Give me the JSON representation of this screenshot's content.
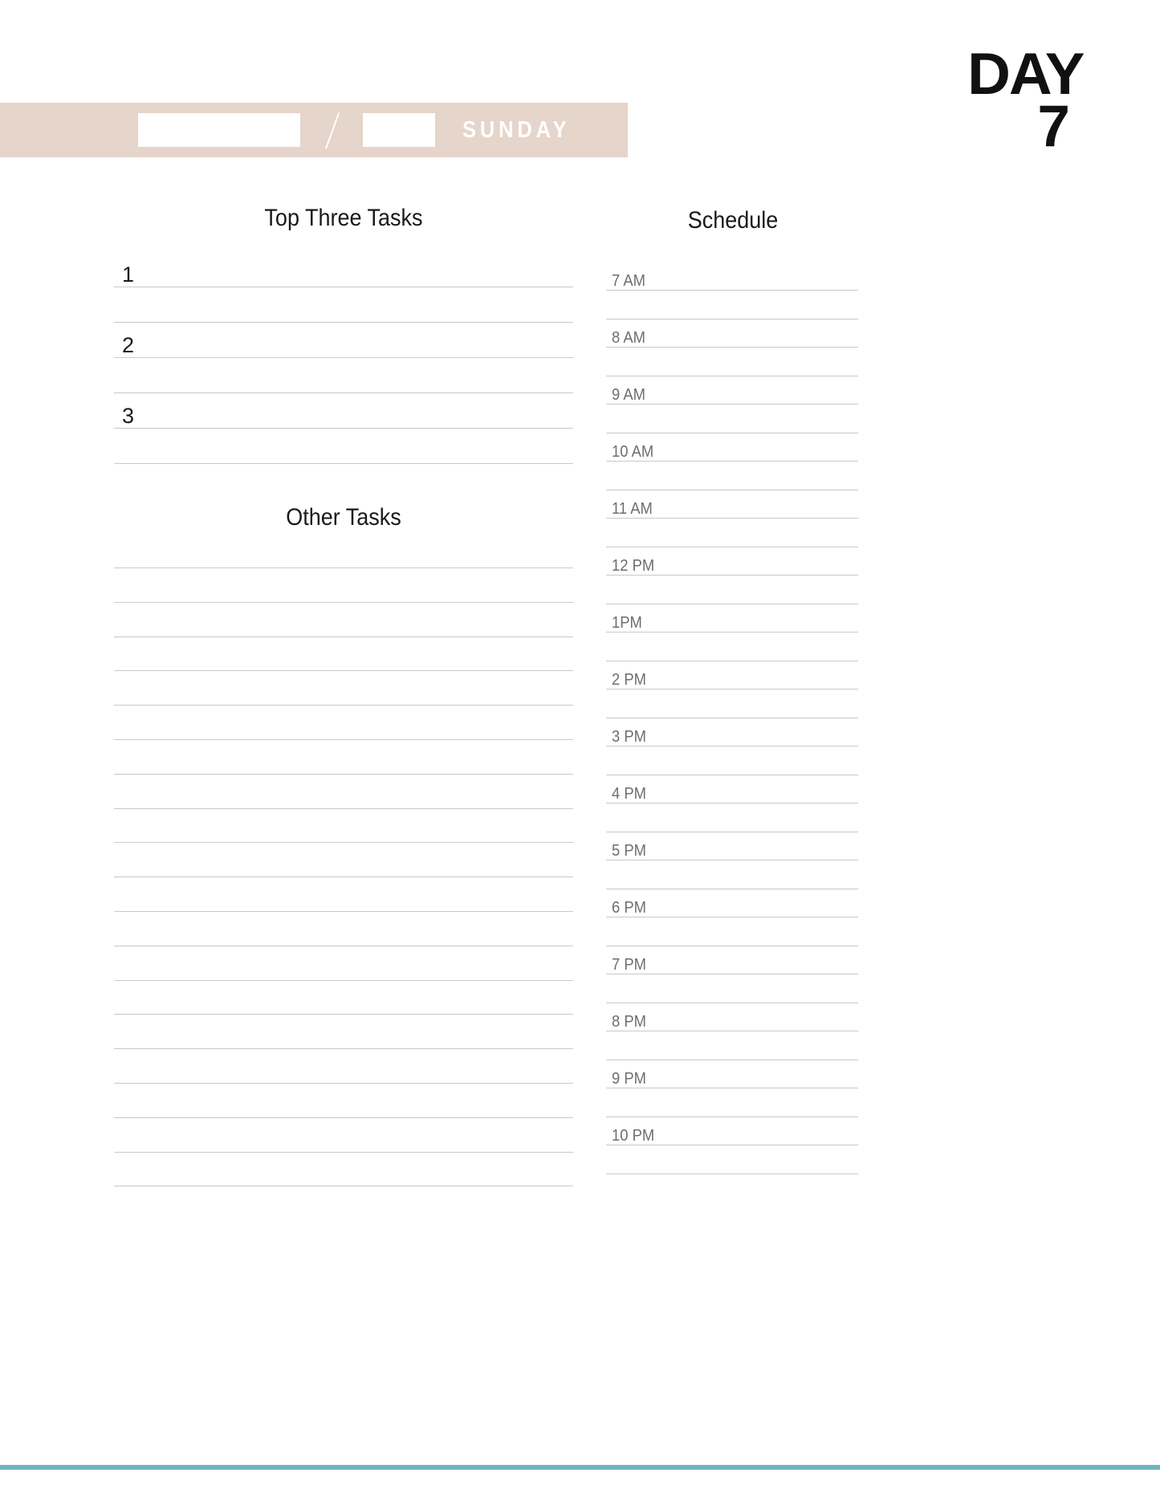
{
  "page": {
    "accent_beige": "#E6D5CB",
    "accent_teal": "#70B3C0",
    "rule_color": "#C9C9C9"
  },
  "header": {
    "month_value": "",
    "month_placeholder": "",
    "day_value": "",
    "day_placeholder": "",
    "separator": "/",
    "weekday": "SUNDAY"
  },
  "logo": {
    "word": "DAY",
    "number": "7"
  },
  "top_three": {
    "title": "Top Three Tasks",
    "items": [
      {
        "number": "1",
        "value": ""
      },
      {
        "number": "",
        "value": ""
      },
      {
        "number": "2",
        "value": ""
      },
      {
        "number": "",
        "value": ""
      },
      {
        "number": "3",
        "value": ""
      },
      {
        "number": "",
        "value": ""
      }
    ]
  },
  "other_tasks": {
    "title": "Other Tasks",
    "line_count": 19,
    "lines": [
      "",
      "",
      "",
      "",
      "",
      "",
      "",
      "",
      "",
      "",
      "",
      "",
      "",
      "",
      "",
      "",
      "",
      "",
      ""
    ]
  },
  "schedule": {
    "title": "Schedule",
    "rows": [
      {
        "label": "7 AM",
        "value": ""
      },
      {
        "label": "",
        "value": ""
      },
      {
        "label": "8 AM",
        "value": ""
      },
      {
        "label": "",
        "value": ""
      },
      {
        "label": "9 AM",
        "value": ""
      },
      {
        "label": "",
        "value": ""
      },
      {
        "label": "10 AM",
        "value": ""
      },
      {
        "label": "",
        "value": ""
      },
      {
        "label": "11 AM",
        "value": ""
      },
      {
        "label": "",
        "value": ""
      },
      {
        "label": "12 PM",
        "value": ""
      },
      {
        "label": "",
        "value": ""
      },
      {
        "label": "1PM",
        "value": ""
      },
      {
        "label": "",
        "value": ""
      },
      {
        "label": "2 PM",
        "value": ""
      },
      {
        "label": "",
        "value": ""
      },
      {
        "label": "3 PM",
        "value": ""
      },
      {
        "label": "",
        "value": ""
      },
      {
        "label": "4 PM",
        "value": ""
      },
      {
        "label": "",
        "value": ""
      },
      {
        "label": "5 PM",
        "value": ""
      },
      {
        "label": "",
        "value": ""
      },
      {
        "label": "6 PM",
        "value": ""
      },
      {
        "label": "",
        "value": ""
      },
      {
        "label": "7 PM",
        "value": ""
      },
      {
        "label": "",
        "value": ""
      },
      {
        "label": "8 PM",
        "value": ""
      },
      {
        "label": "",
        "value": ""
      },
      {
        "label": "9 PM",
        "value": ""
      },
      {
        "label": "",
        "value": ""
      },
      {
        "label": "10 PM",
        "value": ""
      },
      {
        "label": "",
        "value": ""
      }
    ]
  }
}
